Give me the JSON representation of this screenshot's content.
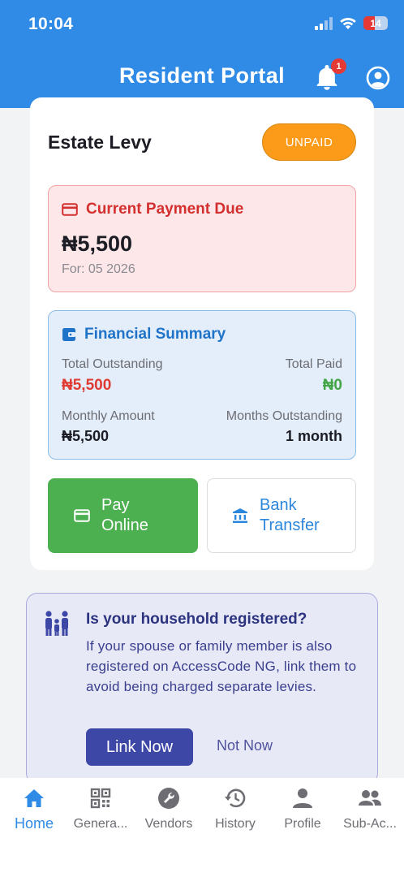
{
  "status_bar": {
    "time": "10:04",
    "battery": "14"
  },
  "header": {
    "title": "Resident Portal",
    "notification_count": "1"
  },
  "levy": {
    "title": "Estate Levy",
    "status": "UNPAID",
    "due": {
      "heading": "Current Payment Due",
      "amount": "₦5,500",
      "for_label": "For: ",
      "for_value": "05 2026"
    },
    "summary": {
      "heading": "Financial Summary",
      "total_outstanding_label": "Total Outstanding",
      "total_outstanding": "₦5,500",
      "total_paid_label": "Total Paid",
      "total_paid": "₦0",
      "monthly_amount_label": "Monthly Amount",
      "monthly_amount": "₦5,500",
      "months_outstanding_label": "Months Outstanding",
      "months_outstanding": "1 month"
    },
    "pay_online": {
      "line1": "Pay",
      "line2": "Online"
    },
    "bank_transfer": {
      "line1": "Bank",
      "line2": "Transfer"
    }
  },
  "household": {
    "title": "Is your household registered?",
    "text": "If your spouse or family member is also registered on AccessCode NG, link them to avoid being charged separate levies.",
    "link_now": "Link Now",
    "not_now": "Not Now"
  },
  "nav": [
    {
      "label": "Home",
      "icon": "home-icon"
    },
    {
      "label": "Genera...",
      "icon": "qr-code-icon"
    },
    {
      "label": "Vendors",
      "icon": "wrench-icon"
    },
    {
      "label": "History",
      "icon": "history-icon"
    },
    {
      "label": "Profile",
      "icon": "person-icon"
    },
    {
      "label": "Sub-Ac...",
      "icon": "group-icon"
    }
  ],
  "colors": {
    "primary": "#2f8be6",
    "unpaid": "#fb9b19",
    "due_red": "#d42f2f",
    "summary_blue": "#1f73c8",
    "pay_green": "#4db050",
    "household_indigo": "#3d47a5"
  }
}
